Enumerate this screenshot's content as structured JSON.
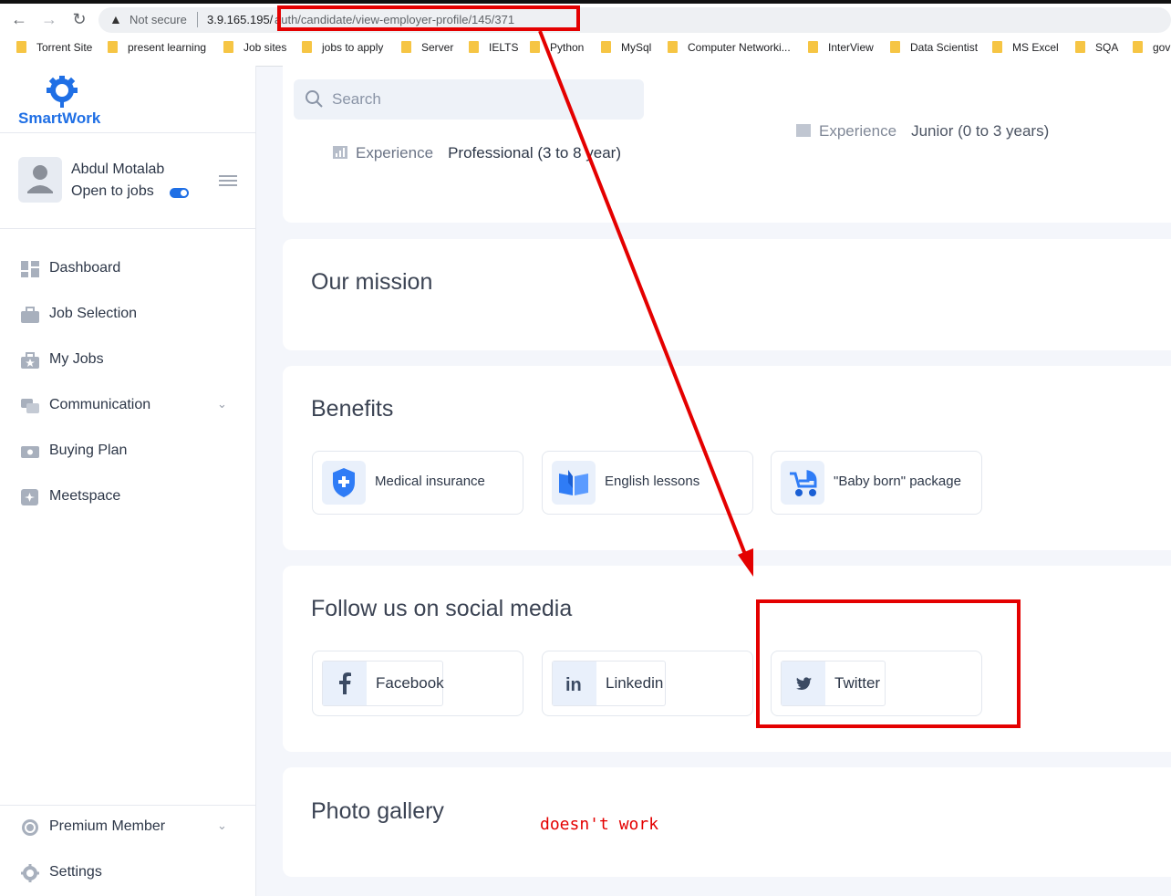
{
  "browser": {
    "security_label": "Not secure",
    "url_host": "3.9.165.195/",
    "url_path": "auth/candidate/view-employer-profile/145/371",
    "bookmarks": [
      "Torrent Site",
      "present learning",
      "Job sites",
      "jobs to apply",
      "Server",
      "IELTS",
      "Python",
      "MySql",
      "Computer Networki...",
      "InterView",
      "Data Scientist",
      "MS Excel",
      "SQA",
      "gov"
    ]
  },
  "sidebar": {
    "brand": "SmartWork",
    "user_name": "Abdul Motalab",
    "status": "Open to jobs",
    "open_to_jobs": true,
    "menu": [
      "Dashboard",
      "Job Selection",
      "My Jobs",
      "Communication",
      "Buying Plan",
      "Meetspace"
    ],
    "bottom_menu": [
      "Premium Member",
      "Settings"
    ]
  },
  "search": {
    "placeholder": "Search"
  },
  "profile": {
    "experience_label": "Experience",
    "experience_value": "Professional (3 to 8 year)",
    "experience_label_2": "Experience",
    "experience_value_2": "Junior (0 to 3 years)",
    "mission_title": "Our mission",
    "benefits_title": "Benefits",
    "benefits": [
      "Medical insurance",
      "English lessons",
      "\"Baby born\" package"
    ],
    "social_title": "Follow us on social media",
    "social": [
      "Facebook",
      "Linkedin",
      "Twitter"
    ],
    "gallery_title": "Photo gallery"
  },
  "annotation": {
    "note": "doesn't work",
    "color": "#e40000"
  },
  "colors": {
    "brand": "#1f6fe5",
    "accent_bg": "#e9f0fb"
  }
}
